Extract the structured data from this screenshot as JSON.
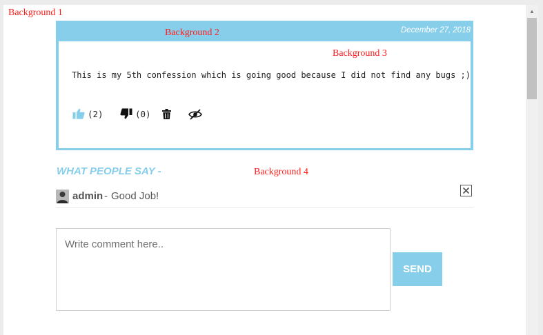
{
  "labels": {
    "bg1": "Background 1",
    "bg2": "Background 2",
    "bg3": "Background 3",
    "bg4": "Background 4"
  },
  "confession": {
    "date": "December 27, 2018",
    "text": "This is my 5th confession which is going good because I did not find any bugs ;)",
    "likes": "(2)",
    "dislikes": "(0)",
    "icons": [
      "thumbs-up-icon",
      "thumbs-down-icon",
      "trash-icon",
      "eye-slash-icon"
    ]
  },
  "section_title": "WHAT PEOPLE SAY -",
  "comment": {
    "author": "admin",
    "separator": "-",
    "text": "Good Job!"
  },
  "comment_form": {
    "placeholder": "Write comment here..",
    "send_label": "SEND"
  },
  "colors": {
    "accent": "#87ceeb",
    "label_red": "#ff1a1a",
    "text": "#555555"
  }
}
